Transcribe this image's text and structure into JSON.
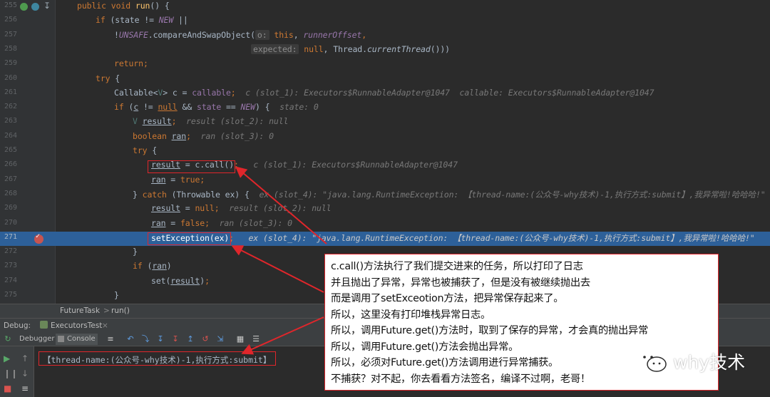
{
  "editor": {
    "lines": [
      {
        "n": "255",
        "indent": 108,
        "segs": [
          [
            "public void ",
            "#cc7832"
          ],
          [
            "run",
            "#ffc66d"
          ],
          [
            "() {",
            "#a9b7c6"
          ]
        ]
      },
      {
        "n": "256",
        "indent": 134,
        "segs": [
          [
            "if",
            "#cc7832"
          ],
          [
            " (state != ",
            "#a9b7c6"
          ],
          [
            "NEW",
            "#9876aa",
            "i"
          ],
          [
            " ||",
            "#a9b7c6"
          ]
        ]
      },
      {
        "n": "257",
        "indent": 160,
        "segs": [
          [
            "!",
            "#a9b7c6"
          ],
          [
            "UNSAFE",
            "#9876aa",
            "i"
          ],
          [
            ".compareAndSwapObject(",
            "#a9b7c6"
          ],
          [
            "o:",
            "hint"
          ],
          [
            " this",
            "#cc7832"
          ],
          [
            ", ",
            "#a9b7c6"
          ],
          [
            "runnerOffset",
            "#9876aa",
            "i"
          ],
          [
            ",",
            "#cc7832"
          ]
        ]
      },
      {
        "n": "258",
        "indent": 352,
        "segs": [
          [
            "expected:",
            "hint"
          ],
          [
            " null",
            "#cc7832"
          ],
          [
            ", Thread.",
            "#a9b7c6"
          ],
          [
            "currentThread",
            "#a9b7c6",
            "i"
          ],
          [
            "()))",
            "#a9b7c6"
          ]
        ]
      },
      {
        "n": "259",
        "indent": 160,
        "segs": [
          [
            "return",
            "#cc7832"
          ],
          [
            ";",
            "#cc7832"
          ]
        ]
      },
      {
        "n": "260",
        "indent": 134,
        "segs": [
          [
            "try",
            "#cc7832"
          ],
          [
            " {",
            "#a9b7c6"
          ]
        ]
      },
      {
        "n": "261",
        "indent": 160,
        "segs": [
          [
            "Callable<",
            "#a9b7c6"
          ],
          [
            "V",
            "#507874"
          ],
          [
            "> c = ",
            "#a9b7c6"
          ],
          [
            "callable",
            "#9876aa"
          ],
          [
            ";",
            "#cc7832"
          ],
          [
            "  c (slot_1): Executors$RunnableAdapter@1047  callable: Executors$RunnableAdapter@1047",
            "dbg"
          ]
        ]
      },
      {
        "n": "262",
        "indent": 160,
        "segs": [
          [
            "if",
            "#cc7832"
          ],
          [
            " (",
            "#a9b7c6"
          ],
          [
            "c",
            "#a9b7c6",
            "u"
          ],
          [
            " != ",
            "#a9b7c6"
          ],
          [
            "null",
            "#cc7832",
            "u"
          ],
          [
            " && ",
            "#a9b7c6"
          ],
          [
            "state",
            "#9876aa"
          ],
          [
            " == ",
            "#a9b7c6"
          ],
          [
            "NEW",
            "#9876aa",
            "i"
          ],
          [
            ") {",
            "#a9b7c6"
          ],
          [
            "  state: 0",
            "dbg"
          ]
        ]
      },
      {
        "n": "263",
        "indent": 186,
        "segs": [
          [
            "V ",
            "#507874"
          ],
          [
            "result",
            "#a9b7c6",
            "u"
          ],
          [
            ";",
            "#cc7832"
          ],
          [
            "  result (slot_2): null",
            "dbg"
          ]
        ]
      },
      {
        "n": "264",
        "indent": 186,
        "segs": [
          [
            "boolean ",
            "#cc7832"
          ],
          [
            "ran",
            "#a9b7c6",
            "u"
          ],
          [
            ";",
            "#cc7832"
          ],
          [
            "  ran (slot_3): 0",
            "dbg"
          ]
        ]
      },
      {
        "n": "265",
        "indent": 186,
        "segs": [
          [
            "try",
            "#cc7832"
          ],
          [
            " {",
            "#a9b7c6"
          ]
        ]
      },
      {
        "n": "266",
        "indent": 212,
        "segs": [
          [
            "result",
            "#a9b7c6",
            "u"
          ],
          [
            " = c.call()",
            "#a9b7c6"
          ],
          [
            ";",
            "#cc7832"
          ],
          [
            "   c (slot_1): Executors$RunnableAdapter@1047",
            "dbg"
          ]
        ]
      },
      {
        "n": "267",
        "indent": 212,
        "segs": [
          [
            "ran",
            "#a9b7c6",
            "u"
          ],
          [
            " = ",
            "#a9b7c6"
          ],
          [
            "true",
            "#cc7832"
          ],
          [
            ";",
            "#cc7832"
          ]
        ]
      },
      {
        "n": "268",
        "indent": 186,
        "segs": [
          [
            "} ",
            "#a9b7c6"
          ],
          [
            "catch",
            "#cc7832"
          ],
          [
            " (Throwable ex) {",
            "#a9b7c6"
          ],
          [
            "  ex (slot_4): \"java.lang.RuntimeException: 【thread-name:(公众号-why技术)-1,执行方式:submit】,我异常啦!哈哈哈!\"",
            "dbg"
          ]
        ]
      },
      {
        "n": "269",
        "indent": 212,
        "segs": [
          [
            "result",
            "#a9b7c6",
            "u"
          ],
          [
            " = ",
            "#a9b7c6"
          ],
          [
            "null",
            "#cc7832"
          ],
          [
            ";",
            "#cc7832"
          ],
          [
            "  result (slot_2): null",
            "dbg"
          ]
        ]
      },
      {
        "n": "270",
        "indent": 212,
        "segs": [
          [
            "ran",
            "#a9b7c6",
            "u"
          ],
          [
            " = ",
            "#a9b7c6"
          ],
          [
            "false",
            "#cc7832"
          ],
          [
            ";",
            "#cc7832"
          ],
          [
            "  ran (slot_3): 0",
            "dbg"
          ]
        ]
      },
      {
        "n": "271",
        "indent": 212,
        "hl": true,
        "segs": [
          [
            "setException(ex)",
            "#ffffff"
          ],
          [
            ";",
            "#cc7832"
          ],
          [
            "   ex (slot_4): \"java.lang.RuntimeException: 【thread-name:(公众号-why技术)-1,执行方式:submit】,我异常啦!哈哈哈!\"",
            "dbg"
          ]
        ]
      },
      {
        "n": "272",
        "indent": 186,
        "segs": [
          [
            "}",
            "#a9b7c6"
          ]
        ]
      },
      {
        "n": "273",
        "indent": 186,
        "segs": [
          [
            "if",
            "#cc7832"
          ],
          [
            " (",
            "#a9b7c6"
          ],
          [
            "ran",
            "#a9b7c6",
            "u"
          ],
          [
            ")",
            "#a9b7c6"
          ]
        ]
      },
      {
        "n": "274",
        "indent": 212,
        "segs": [
          [
            "set(",
            "#a9b7c6"
          ],
          [
            "result",
            "#a9b7c6",
            "u"
          ],
          [
            ")",
            "#a9b7c6"
          ],
          [
            ";",
            "#cc7832"
          ]
        ]
      },
      {
        "n": "275",
        "indent": 160,
        "segs": [
          [
            "}",
            "#a9b7c6"
          ]
        ]
      }
    ]
  },
  "breadcrumb": {
    "class_name": "FutureTask",
    "separator": ">",
    "method": "run()"
  },
  "debug": {
    "label": "Debug:",
    "session_tab": "ExecutorsTest",
    "debugger_tab": "Debugger",
    "console_tab": "Console",
    "console_output": "【thread-name:(公众号-why技术)-1,执行方式:submit】"
  },
  "annotation": [
    "c.call()方法执行了我们提交进来的任务，所以打印了日志",
    "并且抛出了异常，异常也被捕获了，但是没有被继续抛出去",
    "而是调用了setExceotion方法，把异常保存起来了。",
    "所以，这里没有打印堆栈异常日志。",
    "所以，调用Future.get()方法时，取到了保存的异常，才会真的抛出异常",
    "所以，调用Future.get()方法会抛出异常。",
    "所以，必须对Future.get()方法调用进行异常捕获。",
    "不捕获？对不起，你去看看方法签名，编译不过啊，老哥！"
  ],
  "watermark": {
    "text": "why技术",
    "icon": "wechat-icon"
  },
  "colors": {
    "annotation_border": "#e0262b",
    "highlight_line": "#2d6099",
    "breakpoint": "#c75450"
  }
}
